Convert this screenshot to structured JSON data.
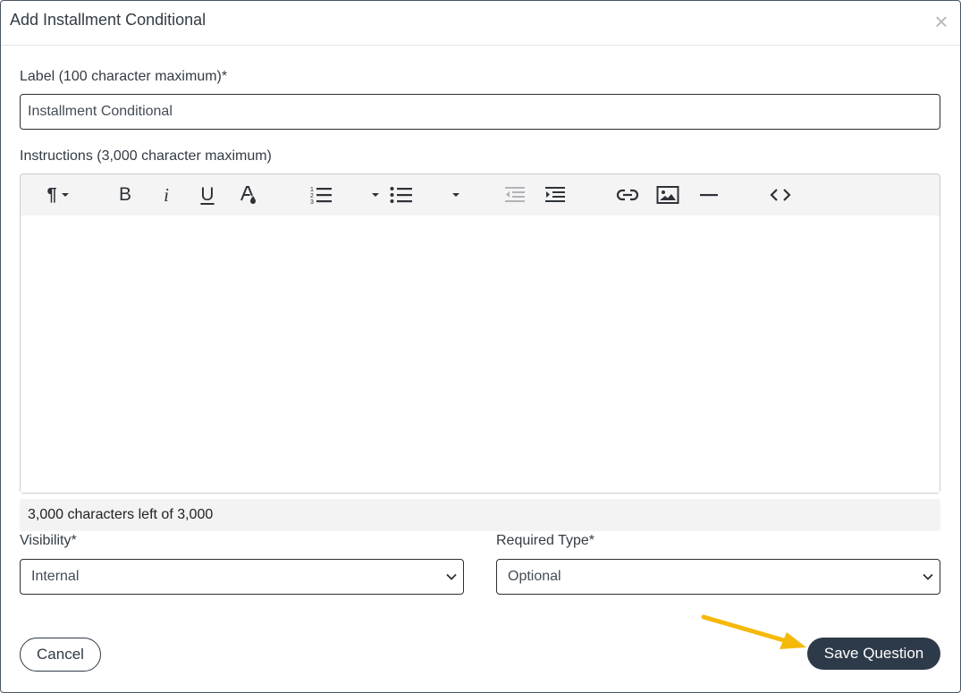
{
  "dialog": {
    "title": "Add Installment Conditional",
    "close_symbol": "×"
  },
  "label_field": {
    "label": "Label (100 character maximum)*",
    "value": "Installment Conditional"
  },
  "instructions_field": {
    "label": "Instructions (3,000 character maximum)",
    "toolbar_icons": [
      "paragraph-format-icon",
      "bold-icon",
      "italic-icon",
      "underline-icon",
      "text-color-icon",
      "ordered-list-icon",
      "unordered-list-icon",
      "outdent-icon",
      "indent-icon",
      "link-icon",
      "image-icon",
      "horizontal-line-icon",
      "code-view-icon"
    ],
    "bold_glyph": "B",
    "italic_glyph": "i",
    "underline_glyph": "U",
    "paragraph_glyph": "¶",
    "counter_text": "3,000 characters left of 3,000"
  },
  "visibility_field": {
    "label": "Visibility*",
    "selected": "Internal"
  },
  "required_type_field": {
    "label": "Required Type*",
    "selected": "Optional"
  },
  "actions": {
    "cancel_label": "Cancel",
    "save_label": "Save Question"
  },
  "colors": {
    "primary_button": "#2d3a49",
    "annotation_arrow": "#f5b90a"
  }
}
